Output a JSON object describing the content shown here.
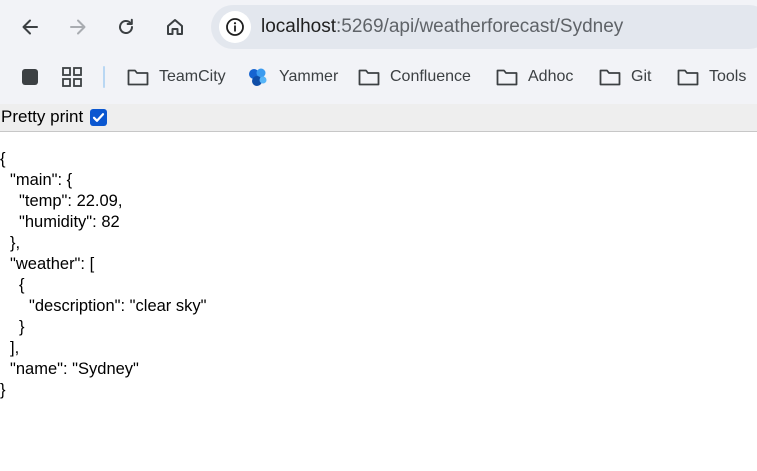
{
  "browser": {
    "url_host": "localhost",
    "url_path": ":5269/api/weatherforecast/Sydney",
    "bookmarks": [
      {
        "label": "TeamCity",
        "icon": "folder-icon"
      },
      {
        "label": "Yammer",
        "icon": "yammer-icon"
      },
      {
        "label": "Confluence",
        "icon": "folder-icon"
      },
      {
        "label": "Adhoc",
        "icon": "folder-icon"
      },
      {
        "label": "Git",
        "icon": "folder-icon"
      },
      {
        "label": "Tools",
        "icon": "folder-icon"
      }
    ]
  },
  "pretty_print": {
    "label": "Pretty print",
    "checked": true
  },
  "json_lines": [
    "{",
    "\"main\": {",
    "\"temp\": 22.09,",
    "\"humidity\": 82",
    "},",
    "\"weather\": [",
    "{",
    "\"description\": \"clear sky\"",
    "}",
    "],",
    "\"name\": \"Sydney\"",
    "}"
  ],
  "colors": {
    "accent": "#0b57d0",
    "toolbar_bg": "#f2f3f7",
    "omnibox_bg": "#e3e7ee"
  }
}
